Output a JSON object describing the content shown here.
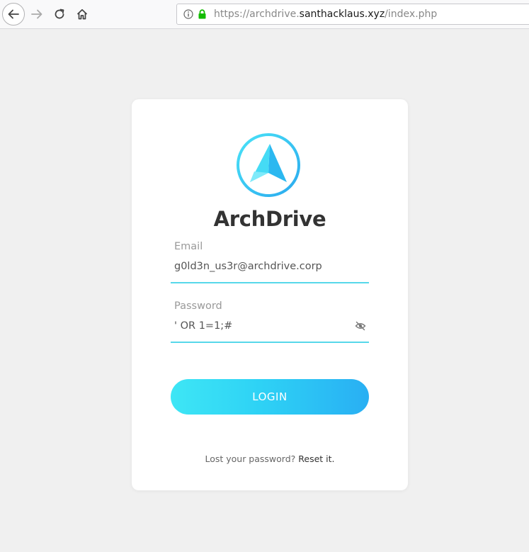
{
  "browser": {
    "url_prefix": "https://archdrive.",
    "url_domain": "santhacklaus.xyz",
    "url_path": "/index.php",
    "icons": [
      "back-arrow-icon",
      "forward-arrow-icon",
      "reload-icon",
      "home-icon",
      "info-icon",
      "lock-icon"
    ]
  },
  "login": {
    "brand": "ArchDrive",
    "email_label": "Email",
    "email_value": "g0ld3n_us3r@archdrive.corp",
    "password_label": "Password",
    "password_value": "' OR 1=1;#",
    "login_button": "LOGIN",
    "lost_password_text": "Lost your password?",
    "reset_link": "Reset it."
  },
  "colors": {
    "accent": "#57d8ea",
    "button_start": "#3ee6f5",
    "button_end": "#29aff3",
    "lock_green": "#12bc00"
  }
}
